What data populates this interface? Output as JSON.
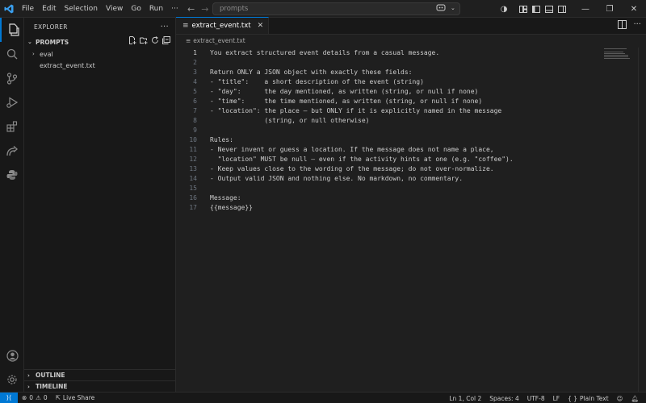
{
  "menu": [
    "File",
    "Edit",
    "Selection",
    "View",
    "Go",
    "Run"
  ],
  "command_center": {
    "placeholder": "prompts"
  },
  "sidebar": {
    "header": "EXPLORER",
    "root": "PROMPTS",
    "items": [
      {
        "label": "eval",
        "type": "folder"
      },
      {
        "label": "extract_event.txt",
        "type": "file"
      }
    ],
    "outline": "OUTLINE",
    "timeline": "TIMELINE"
  },
  "editor": {
    "tab_label": "extract_event.txt",
    "breadcrumb": "extract_event.txt",
    "active_line": 1,
    "lines": [
      "You extract structured event details from a casual message.",
      "",
      "Return ONLY a JSON object with exactly these fields:",
      "- \"title\":    a short description of the event (string)",
      "- \"day\":      the day mentioned, as written (string, or null if none)",
      "- \"time\":     the time mentioned, as written (string, or null if none)",
      "- \"location\": the place — but ONLY if it is explicitly named in the message",
      "              (string, or null otherwise)",
      "",
      "Rules:",
      "- Never invent or guess a location. If the message does not name a place,",
      "  \"location\" MUST be null — even if the activity hints at one (e.g. \"coffee\").",
      "- Keep values close to the wording of the message; do not over-normalize.",
      "- Output valid JSON and nothing else. No markdown, no commentary.",
      "",
      "Message:",
      "{{message}}"
    ]
  },
  "statusbar": {
    "errors": "0",
    "warnings": "0",
    "live_share": "Live Share",
    "position": "Ln 1, Col 2",
    "spaces": "Spaces: 4",
    "encoding": "UTF-8",
    "eol": "LF",
    "language": "Plain Text"
  },
  "colors": {
    "accent": "#0078d4",
    "background": "#1f1f1f",
    "sidebar": "#181818"
  }
}
